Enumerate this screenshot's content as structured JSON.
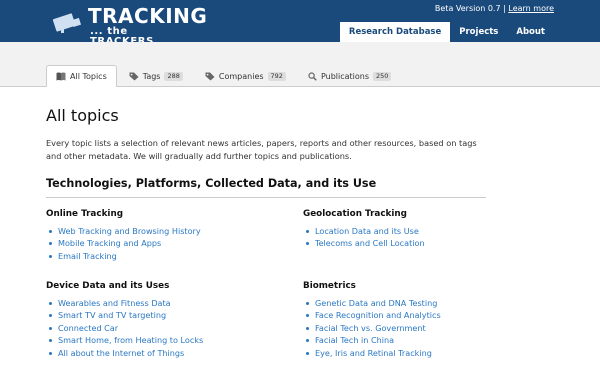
{
  "header": {
    "logo_title": "TRACKING",
    "logo_subtitle": "... the TRACKERS",
    "version_text": "Beta Version 0.7",
    "version_separator": "|",
    "version_link": "Learn more",
    "nav": [
      {
        "label": "Research Database",
        "active": true
      },
      {
        "label": "Projects",
        "active": false
      },
      {
        "label": "About",
        "active": false
      }
    ]
  },
  "tabs": [
    {
      "label": "All Topics",
      "icon": "book-icon",
      "count": null,
      "active": true
    },
    {
      "label": "Tags",
      "icon": "tag-icon",
      "count": "288",
      "active": false
    },
    {
      "label": "Companies",
      "icon": "tag-icon",
      "count": "792",
      "active": false
    },
    {
      "label": "Publications",
      "icon": "search-icon",
      "count": "250",
      "active": false
    }
  ],
  "main": {
    "title": "All topics",
    "intro": "Every topic lists a selection of relevant news articles, papers, reports and other resources, based on tags and other metadata. We will gradually add further topics and publications.",
    "section_title": "Technologies, Platforms, Collected Data, and its Use"
  },
  "groups": [
    {
      "title": "Online Tracking",
      "items": [
        "Web Tracking and Browsing History",
        "Mobile Tracking and Apps",
        "Email Tracking"
      ]
    },
    {
      "title": "Geolocation Tracking",
      "items": [
        "Location Data and its Use",
        "Telecoms and Cell Location"
      ]
    },
    {
      "title": "Device Data and its Uses",
      "items": [
        "Wearables and Fitness Data",
        "Smart TV and TV targeting",
        "Connected Car",
        "Smart Home, from Heating to Locks",
        "All about the Internet of Things"
      ]
    },
    {
      "title": "Biometrics",
      "items": [
        "Genetic Data and DNA Testing",
        "Face Recognition and Analytics",
        "Facial Tech vs. Government",
        "Facial Tech in China",
        "Eye, Iris and Retinal Tracking"
      ]
    }
  ],
  "colors": {
    "header_bg": "#1a4a7c",
    "link": "#2a78c3"
  }
}
